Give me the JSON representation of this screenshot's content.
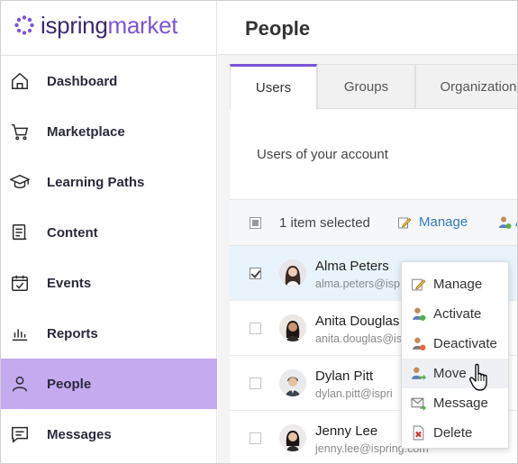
{
  "brand": {
    "part1": "ispring",
    "part2": "market"
  },
  "nav": [
    {
      "label": "Dashboard",
      "icon": "home-icon",
      "active": false
    },
    {
      "label": "Marketplace",
      "icon": "cart-icon",
      "active": false
    },
    {
      "label": "Learning Paths",
      "icon": "graduation-cap-icon",
      "active": false
    },
    {
      "label": "Content",
      "icon": "content-icon",
      "active": false
    },
    {
      "label": "Events",
      "icon": "calendar-check-icon",
      "active": false
    },
    {
      "label": "Reports",
      "icon": "bar-chart-icon",
      "active": false
    },
    {
      "label": "People",
      "icon": "person-icon",
      "active": true
    },
    {
      "label": "Messages",
      "icon": "message-icon",
      "active": false
    }
  ],
  "page": {
    "title": "People"
  },
  "tabs": [
    {
      "label": "Users",
      "active": true
    },
    {
      "label": "Groups",
      "active": false
    },
    {
      "label": "Organization",
      "active": false
    }
  ],
  "panel": {
    "subtitle": "Users of your account"
  },
  "toolbar": {
    "selected": "1 item selected",
    "manage": "Manage",
    "activate": "A"
  },
  "users": [
    {
      "name": "Alma Peters",
      "email": "alma.peters@isp",
      "checked": true,
      "badge": "#f2a83a"
    },
    {
      "name": "Anita Douglas",
      "email": "anita.douglas@is",
      "checked": false,
      "badge": "#e46a5a"
    },
    {
      "name": "Dylan Pitt",
      "email": "dylan.pitt@ispri",
      "checked": false,
      "badge": ""
    },
    {
      "name": "Jenny Lee",
      "email": "jenny.lee@ispring.com",
      "checked": false,
      "badge": ""
    }
  ],
  "menu": [
    {
      "label": "Manage",
      "icon": "manage-icon"
    },
    {
      "label": "Activate",
      "icon": "activate-user-icon"
    },
    {
      "label": "Deactivate",
      "icon": "deactivate-user-icon"
    },
    {
      "label": "Move",
      "icon": "move-user-icon"
    },
    {
      "label": "Message",
      "icon": "envelope-icon"
    },
    {
      "label": "Delete",
      "icon": "delete-icon"
    }
  ],
  "colors": {
    "accent": "#7b55d8",
    "active_nav": "#c4aaee",
    "link": "#2f7bbf",
    "selected_row": "#e9f3fb"
  }
}
